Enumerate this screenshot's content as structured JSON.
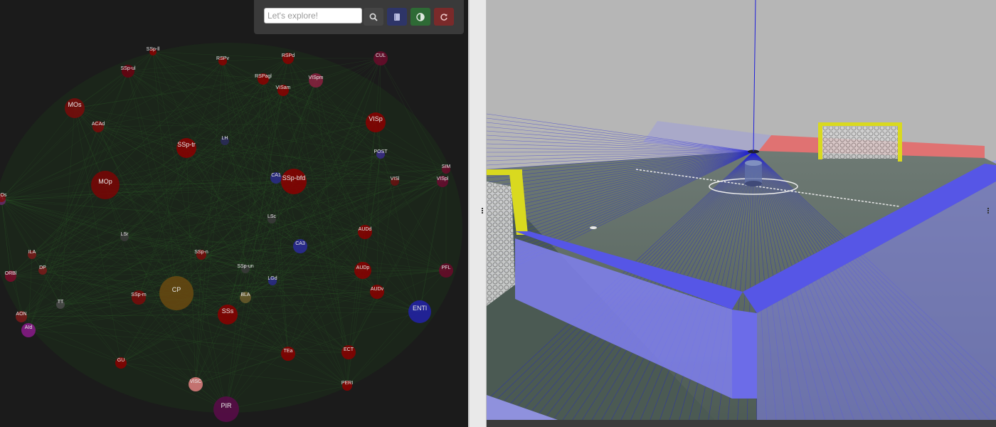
{
  "toolbar": {
    "search_placeholder": "Let's explore!",
    "search_icon": "magnifier-icon",
    "info_icon": "book-icon",
    "contrast_icon": "contrast-icon",
    "reset_icon": "refresh-icon"
  },
  "graph": {
    "node_labels": [
      "SSp-ll",
      "RSPd",
      "RSPv",
      "RSPagl",
      "VISam",
      "VISpm",
      "SSp-ul",
      "MOs",
      "SSp-tr",
      "ACAd",
      "VISp",
      "POST",
      "CA1",
      "SSp-bfd",
      "MOp",
      "VISl",
      "VISpl",
      "PL",
      "ORBl",
      "MOs",
      "AUDd",
      "LSc",
      "CA3",
      "SSp-n",
      "AUDp",
      "AUDv",
      "ENTl",
      "SSp-m",
      "CP",
      "SSs",
      "ILA",
      "DP",
      "TT",
      "AON",
      "AId",
      "GU",
      "VISC",
      "TEa",
      "ECT",
      "PERI",
      "PIR",
      "BLA",
      "LGd",
      "LH",
      "CUL",
      "SIM",
      "PFL",
      "LSr",
      "SSp-un"
    ],
    "colors": {
      "background": "#1b1b1b",
      "edges": "#2f6b2a",
      "label": "#e8e8e8"
    }
  },
  "scene": {
    "colors": {
      "sky": "#b6b6b6",
      "field": "#5a6a62",
      "walls": "#7b7bf0",
      "wall_top": "#5252e8",
      "far_wall": "#e06c6c",
      "goal_frame": "#d9d91f",
      "laser": "#1f1fd9"
    }
  }
}
